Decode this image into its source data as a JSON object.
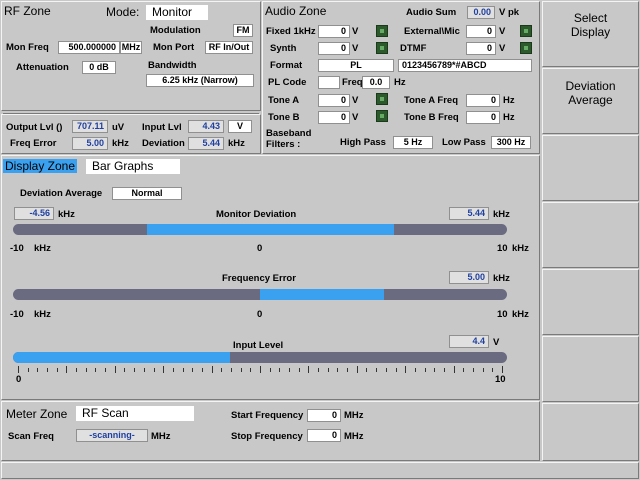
{
  "rf_zone": {
    "title": "RF Zone",
    "mode_label": "Mode:",
    "mode_value": "Monitor",
    "modulation_label": "Modulation",
    "modulation_value": "FM",
    "mon_freq_label": "Mon Freq",
    "mon_freq_value": "500.000000",
    "mon_freq_unit": "MHz",
    "mon_port_label": "Mon Port",
    "mon_port_value": "RF In/Out",
    "attenuation_label": "Attenuation",
    "attenuation_value": "0 dB",
    "bandwidth_label": "Bandwidth",
    "bandwidth_value": "6.25 kHz (Narrow)",
    "output_lvl_label": "Output Lvl ()",
    "output_lvl_value": "707.11",
    "output_lvl_unit": "uV",
    "input_lvl_label": "Input Lvl",
    "input_lvl_value": "4.43",
    "input_lvl_unit": "V",
    "freq_error_label": "Freq Error",
    "freq_error_value": "5.00",
    "freq_error_unit": "kHz",
    "deviation_label": "Deviation",
    "deviation_value": "5.44",
    "deviation_unit": "kHz"
  },
  "audio_zone": {
    "title": "Audio Zone",
    "audio_sum_label": "Audio Sum",
    "audio_sum_value": "0.00",
    "audio_sum_unit": "V pk",
    "fixed1k_label": "Fixed 1kHz",
    "fixed1k_value": "0",
    "fixed1k_unit": "V",
    "external_label": "External\\Mic",
    "external_value": "0",
    "external_unit": "V",
    "synth_label": "Synth",
    "synth_value": "0",
    "synth_unit": "V",
    "dtmf_label": "DTMF",
    "dtmf_value": "0",
    "dtmf_unit": "V",
    "format_label": "Format",
    "format_value": "PL",
    "dtmf_string": "0123456789*#ABCD",
    "pl_code_label": "PL Code",
    "freq_label": "Freq",
    "freq_value": "0.0",
    "freq_unit": "Hz",
    "tone_a_label": "Tone A",
    "tone_a_value": "0",
    "tone_a_unit": "V",
    "tone_a_freq_label": "Tone A Freq",
    "tone_a_freq_value": "0",
    "tone_a_freq_unit": "Hz",
    "tone_b_label": "Tone B",
    "tone_b_value": "0",
    "tone_b_unit": "V",
    "tone_b_freq_label": "Tone B Freq",
    "tone_b_freq_value": "0",
    "tone_b_freq_unit": "Hz",
    "baseband_label_1": "Baseband",
    "baseband_label_2": "Filters :",
    "high_pass_label": "High Pass",
    "high_pass_value": "5 Hz",
    "low_pass_label": "Low Pass",
    "low_pass_value": "300 Hz"
  },
  "display_zone": {
    "title": "Display Zone",
    "view": "Bar Graphs",
    "deviation_average_label": "Deviation Average",
    "deviation_average_value": "Normal",
    "monitor_deviation": {
      "title": "Monitor Deviation",
      "left_value": "-4.56",
      "left_unit": "kHz",
      "right_value": "5.44",
      "right_unit": "kHz",
      "scale_min": "-10",
      "scale_mid": "0",
      "scale_max": "10",
      "scale_unit": "kHz",
      "fill_start": -4.56,
      "fill_end": 5.44,
      "range": [
        -10,
        10
      ]
    },
    "frequency_error": {
      "title": "Frequency Error",
      "right_value": "5.00",
      "right_unit": "kHz",
      "scale_min": "-10",
      "scale_mid": "0",
      "scale_max": "10",
      "scale_unit": "kHz",
      "fill_start": 0,
      "fill_end": 5.0,
      "range": [
        -10,
        10
      ]
    },
    "input_level": {
      "title": "Input Level",
      "right_value": "4.4",
      "right_unit": "V",
      "scale_min": "0",
      "scale_max": "10",
      "fill_start": 0,
      "fill_end": 4.4,
      "range": [
        0,
        10
      ]
    }
  },
  "meter_zone": {
    "title": "Meter Zone",
    "view": "RF Scan",
    "scan_freq_label": "Scan Freq",
    "scan_freq_value": "-scanning-",
    "scan_freq_unit": "MHz",
    "start_freq_label": "Start Frequency",
    "start_freq_value": "0",
    "start_freq_unit": "MHz",
    "stop_freq_label": "Stop Frequency",
    "stop_freq_value": "0",
    "stop_freq_unit": "MHz"
  },
  "softkeys": {
    "key1_line1": "Select",
    "key1_line2": "Display",
    "key2_line1": "Deviation",
    "key2_line2": "Average"
  },
  "colors": {
    "bar_fill": "#3aa0f0",
    "bar_track": "#6a6a80",
    "zone_title_highlight": "#3aa0f0"
  }
}
